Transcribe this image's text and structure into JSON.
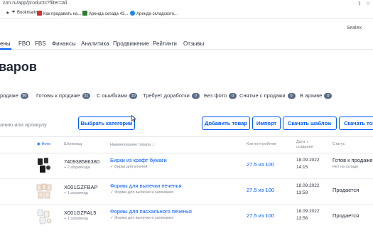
{
  "browser": {
    "url": "zon.ru/app/products?filter=all",
    "bookmarks": [
      "Bookmarks",
      "Как продавать на...",
      "Аренда склада 43...",
      "Аренда складского..."
    ]
  },
  "header": {
    "seller": "Sealex"
  },
  "nav": {
    "items": [
      "ены",
      "FBO",
      "FBS",
      "Финансы",
      "Аналитика",
      "Продвижение",
      "Рейтинги",
      "Отзывы"
    ]
  },
  "page": {
    "title": "варов"
  },
  "filters": [
    {
      "label": "родаже",
      "count": "90"
    },
    {
      "label": "Готовы к продаже",
      "count": "31"
    },
    {
      "label": "С ошибками",
      "count": "10"
    },
    {
      "label": "Требует доработки",
      "count": "0"
    },
    {
      "label": "Без фото",
      "count": "0"
    },
    {
      "label": "Снятые с продажи",
      "count": "0"
    },
    {
      "label": "В архиве",
      "count": "0"
    }
  ],
  "toolbar": {
    "search_placeholder": "анию или артикулу",
    "select_categories": "Выбрать категории",
    "add_product": "Добавить товар",
    "import": "Импорт",
    "download_template": "Скачать шаблон",
    "download_products": "Скачать тов"
  },
  "table": {
    "headers": {
      "photo": "Фото",
      "barcode": "Штрихкод",
      "name": "Наименование товара",
      "content_rating": "Контент-рейтинг",
      "date_line1": "Дата",
      "date_line2": "создания",
      "status": "Статус"
    },
    "rows": [
      {
        "barcode": "740938586380",
        "barcode_sub": "+ 2 штрихкода",
        "name": "Бирки из крафт бумаги",
        "name_sub": "Бирки для ключей",
        "rating": "27.5 из 100",
        "date": "18.09.2022",
        "time": "14:15",
        "status": "Готов к продаже",
        "status_sub": "Нет на складе"
      },
      {
        "barcode": "X001GZFBAP",
        "barcode_sub": "+ 1 штрихкод",
        "name": "Формы для выпечки печенья",
        "name_sub": "Форма для выпечки и запекания",
        "rating": "27.5 из 100",
        "date": "18.09.2022",
        "time": "13:59",
        "status": "Продается",
        "status_sub": ""
      },
      {
        "barcode": "X001GZFAL5",
        "barcode_sub": "+ 1 штрихкод",
        "name": "Формы для пасхального печенья",
        "name_sub": "Форма для выпечки и запекания",
        "rating": "27.5 из 100",
        "date": "18.09.2022",
        "time": "13:56",
        "status": "Продается",
        "status_sub": ""
      }
    ]
  },
  "colors": {
    "accent": "#005bff",
    "badge": "#5b6b89",
    "text": "#1f2633",
    "muted": "#7d8590"
  }
}
